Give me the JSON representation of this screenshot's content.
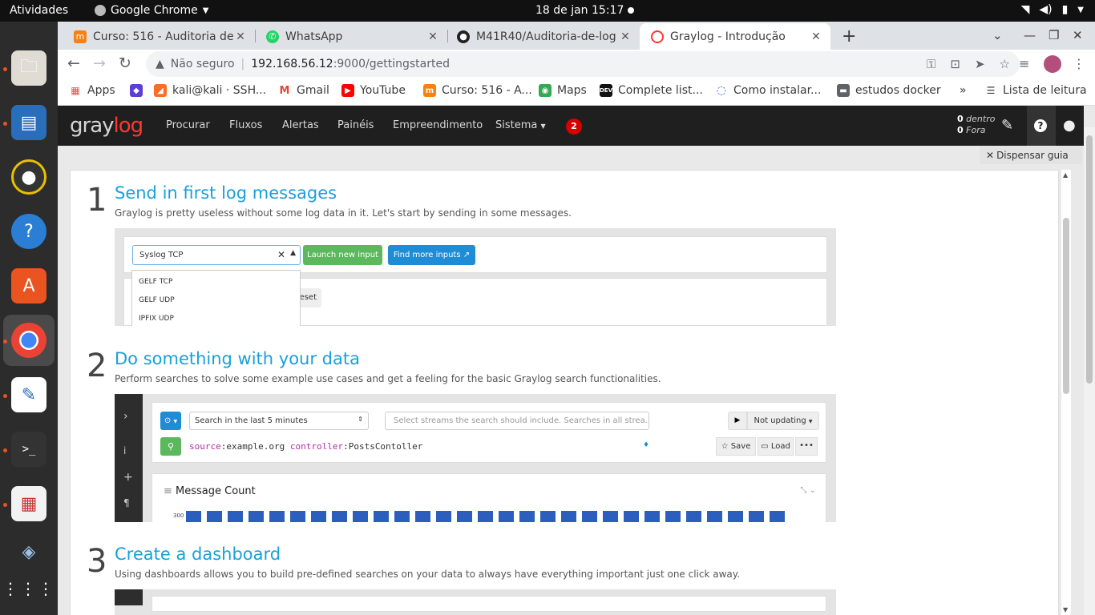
{
  "os": {
    "activities": "Atividades",
    "app_name": "Google Chrome",
    "clock": "18 de jan  15:17"
  },
  "tabs": [
    {
      "title": "Curso: 516 - Auditoria de L",
      "icon": "moodle-icon",
      "color": "#f98012"
    },
    {
      "title": "WhatsApp",
      "icon": "whatsapp-icon",
      "color": "#25d366"
    },
    {
      "title": "M41R40/Auditoria-de-log",
      "icon": "github-icon",
      "color": "#222222"
    },
    {
      "title": "Graylog - Introdução",
      "icon": "graylog-icon",
      "color": "#ff3633"
    }
  ],
  "omnibox": {
    "insecure_label": "Não seguro",
    "host": "192.168.56.12",
    "path": ":9000/gettingstarted"
  },
  "bookmarks": [
    {
      "label": "Apps"
    },
    {
      "label": ""
    },
    {
      "label": "kali@kali · SSH..."
    },
    {
      "label": "Gmail"
    },
    {
      "label": "YouTube"
    },
    {
      "label": "Curso: 516 - A..."
    },
    {
      "label": "Maps"
    },
    {
      "label": "Complete list..."
    },
    {
      "label": "Como instalar..."
    },
    {
      "label": "estudos docker"
    },
    {
      "label": "»"
    },
    {
      "label": "Lista de leitura"
    }
  ],
  "graylog": {
    "logo_a": "gray",
    "logo_b": "log",
    "menu": [
      "Procurar",
      "Fluxos",
      "Alertas",
      "Painéis",
      "Empreendimento",
      "Sistema"
    ],
    "notifications": "2",
    "in_count": "0",
    "in_label": "dentro",
    "out_count": "0",
    "out_label": "Fora",
    "dismiss": "Dispensar guia"
  },
  "steps": [
    {
      "num": "1",
      "title": "Send in first log messages",
      "sub": "Graylog is pretty useless without some log data in it. Let's start by sending in some messages."
    },
    {
      "num": "2",
      "title": "Do something with your data",
      "sub": "Perform searches to solve some example use cases and get a feeling for the basic Graylog search functionalities."
    },
    {
      "num": "3",
      "title": "Create a dashboard",
      "sub": "Using dashboards allows you to build pre-defined searches on your data to always have everything important just one click away."
    }
  ],
  "step1_shot": {
    "select_value": "Syslog TCP",
    "launch_btn": "Launch new input",
    "find_btn": "Find more inputs",
    "reset": "eset",
    "options": [
      "GELF TCP",
      "GELF UDP",
      "IPFIX UDP"
    ]
  },
  "step2_shot": {
    "time_range": "Search in the last 5 minutes",
    "streams_placeholder": "Select streams the search should include. Searches in all strea...",
    "not_updating": "Not updating",
    "query_k1": "source",
    "query_v1": ":example.org ",
    "query_k2": "controller",
    "query_v2": ":PostsContoller",
    "save": "Save",
    "load": "Load",
    "widget_title": "Message Count",
    "y_tick": "300",
    "bars": [
      300,
      300,
      300,
      300,
      300,
      290,
      290,
      290,
      290,
      300,
      290,
      290,
      290,
      290,
      300,
      290,
      290,
      290,
      290,
      290,
      300,
      290,
      290,
      300,
      290,
      290,
      290,
      300,
      290
    ]
  }
}
